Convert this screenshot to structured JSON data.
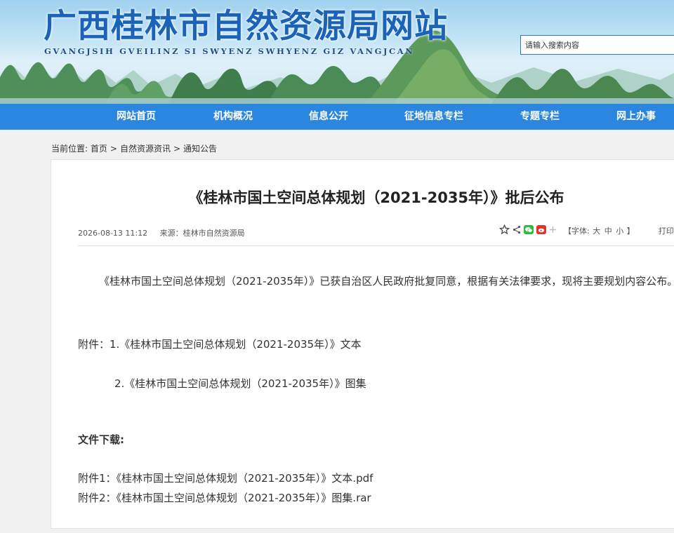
{
  "header": {
    "site_title": "广西桂林市自然资源局网站",
    "site_subtitle": "GVANGJSIH GVEILINZ SI SWYENZ SWHYENZ GIZ VANGJCAN",
    "search_placeholder": "请输入搜索内容"
  },
  "nav": {
    "items": [
      "网站首页",
      "机构概况",
      "信息公开",
      "征地信息专栏",
      "专题专栏",
      "网上办事"
    ]
  },
  "breadcrumb": {
    "prefix": "当前位置:",
    "items": [
      "首页",
      "自然资源资讯",
      "通知公告"
    ],
    "separator": ">"
  },
  "article": {
    "title": "《桂林市国土空间总体规划（2021-2035年）》批后公布",
    "date": "2026-08-13 11:12",
    "source": "来源：桂林市自然资源局",
    "font_size_label": "【字体:",
    "font_sizes": [
      "大",
      "中",
      "小"
    ],
    "font_size_close": "】",
    "print_label": "打印",
    "paragraph": "《桂林市国土空间总体规划（2021-2035年）》已获自治区人民政府批复同意，根据有关法律要求，现将主要规划内容公布。",
    "attachment_1": "附件：1.《桂林市国土空间总体规划（2021-2035年）》文本",
    "attachment_2": "2.《桂林市国土空间总体规划（2021-2035年）》图集",
    "download_heading": "文件下载:",
    "downloads": [
      "附件1：《桂林市国土空间总体规划（2021-2035年）》文本.pdf",
      "附件2：《桂林市国土空间总体规划（2021-2035年）》图集.rar"
    ]
  },
  "colors": {
    "nav_bg": "#2a86de",
    "title_blue": "#1b63b8",
    "wechat_green": "#2dbb3d",
    "weibo_red": "#e0342a"
  },
  "icons": [
    "star-icon",
    "share-icon",
    "wechat-icon",
    "weibo-icon",
    "plus-icon"
  ]
}
